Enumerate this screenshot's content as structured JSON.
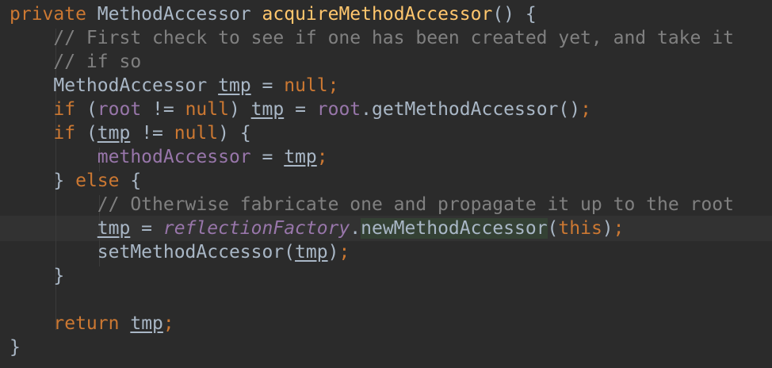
{
  "editor": {
    "lines": [
      [
        {
          "text": "private",
          "cls": "kw"
        },
        {
          "text": " ",
          "cls": "plain"
        },
        {
          "text": "MethodAccessor",
          "cls": "type"
        },
        {
          "text": " ",
          "cls": "plain"
        },
        {
          "text": "acquireMethodAccessor",
          "cls": "fn"
        },
        {
          "text": "() {",
          "cls": "plain"
        }
      ],
      [
        {
          "text": "    ",
          "cls": "plain"
        },
        {
          "text": "// First check to see if one has been created yet, and take it",
          "cls": "cm"
        }
      ],
      [
        {
          "text": "    ",
          "cls": "plain"
        },
        {
          "text": "// if so",
          "cls": "cm"
        }
      ],
      [
        {
          "text": "    ",
          "cls": "plain"
        },
        {
          "text": "MethodAccessor",
          "cls": "type"
        },
        {
          "text": " ",
          "cls": "plain"
        },
        {
          "text": "tmp",
          "cls": "local"
        },
        {
          "text": " = ",
          "cls": "plain"
        },
        {
          "text": "null",
          "cls": "kw"
        },
        {
          "text": ";",
          "cls": "punct"
        }
      ],
      [
        {
          "text": "    ",
          "cls": "plain"
        },
        {
          "text": "if",
          "cls": "kw"
        },
        {
          "text": " (",
          "cls": "plain"
        },
        {
          "text": "root",
          "cls": "field"
        },
        {
          "text": " != ",
          "cls": "plain"
        },
        {
          "text": "null",
          "cls": "kw"
        },
        {
          "text": ") ",
          "cls": "plain"
        },
        {
          "text": "tmp",
          "cls": "local"
        },
        {
          "text": " = ",
          "cls": "plain"
        },
        {
          "text": "root",
          "cls": "field"
        },
        {
          "text": ".getMethodAccessor()",
          "cls": "plain"
        },
        {
          "text": ";",
          "cls": "punct"
        }
      ],
      [
        {
          "text": "    ",
          "cls": "plain"
        },
        {
          "text": "if",
          "cls": "kw"
        },
        {
          "text": " (",
          "cls": "plain"
        },
        {
          "text": "tmp",
          "cls": "local"
        },
        {
          "text": " != ",
          "cls": "plain"
        },
        {
          "text": "null",
          "cls": "kw"
        },
        {
          "text": ") {",
          "cls": "plain"
        }
      ],
      [
        {
          "text": "        ",
          "cls": "plain"
        },
        {
          "text": "methodAccessor",
          "cls": "field"
        },
        {
          "text": " = ",
          "cls": "plain"
        },
        {
          "text": "tmp",
          "cls": "local"
        },
        {
          "text": ";",
          "cls": "punct"
        }
      ],
      [
        {
          "text": "    } ",
          "cls": "plain"
        },
        {
          "text": "else",
          "cls": "kw"
        },
        {
          "text": " {",
          "cls": "plain"
        }
      ],
      [
        {
          "text": "        ",
          "cls": "plain"
        },
        {
          "text": "// Otherwise fabricate one and propagate it up to the root",
          "cls": "cm"
        }
      ],
      [
        {
          "text": "        ",
          "cls": "plain"
        },
        {
          "text": "tmp",
          "cls": "local"
        },
        {
          "text": " = ",
          "cls": "plain"
        },
        {
          "text": "reflectionFactory",
          "cls": "static-field"
        },
        {
          "text": ".",
          "cls": "plain"
        },
        {
          "text": "newMethodAccessor",
          "cls": "plain hl"
        },
        {
          "text": "(",
          "cls": "plain"
        },
        {
          "text": "this",
          "cls": "kw"
        },
        {
          "text": ")",
          "cls": "plain"
        },
        {
          "text": ";",
          "cls": "punct"
        }
      ],
      [
        {
          "text": "        ",
          "cls": "plain"
        },
        {
          "text": "setMethodAccessor(",
          "cls": "plain"
        },
        {
          "text": "tmp",
          "cls": "local"
        },
        {
          "text": ")",
          "cls": "plain"
        },
        {
          "text": ";",
          "cls": "punct"
        }
      ],
      [
        {
          "text": "    }",
          "cls": "plain"
        }
      ],
      [],
      [
        {
          "text": "    ",
          "cls": "plain"
        },
        {
          "text": "return",
          "cls": "kw"
        },
        {
          "text": " ",
          "cls": "plain"
        },
        {
          "text": "tmp",
          "cls": "local"
        },
        {
          "text": ";",
          "cls": "punct"
        }
      ],
      [
        {
          "text": "}",
          "cls": "plain"
        }
      ]
    ]
  },
  "colors": {
    "background": "#2b2b2b",
    "keyword": "#cc7832",
    "method": "#ffc66d",
    "comment": "#808080",
    "field": "#9876aa",
    "text": "#a9b7c6",
    "current_line": "#323232",
    "usage_highlight": "#344134"
  }
}
